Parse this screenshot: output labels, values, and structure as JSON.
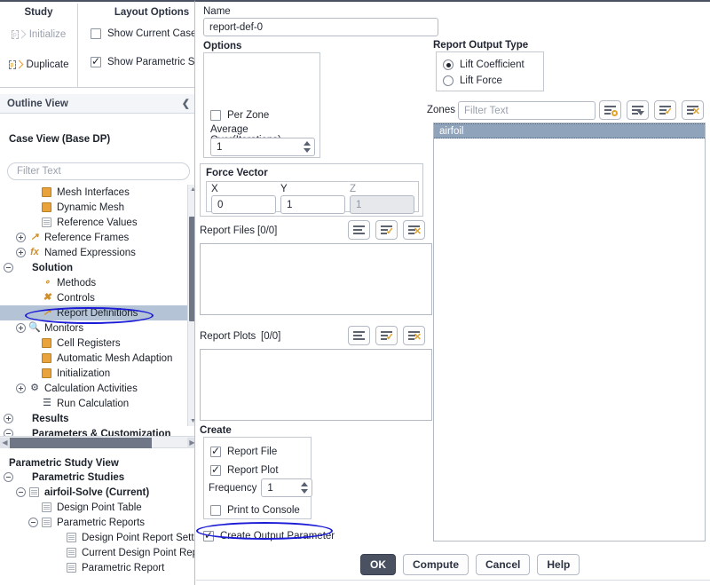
{
  "ribbon": {
    "study": {
      "title": "Study",
      "items": [
        {
          "label": "Initialize",
          "icon": "initialize-icon",
          "disabled": true
        },
        {
          "label": "Duplicate",
          "icon": "duplicate-icon",
          "disabled": false
        }
      ]
    },
    "layout": {
      "title": "Layout Options",
      "items": [
        {
          "label": "Show Current Case Panel",
          "checked": false
        },
        {
          "label": "Show Parametric Study Panel",
          "checked": true
        }
      ]
    }
  },
  "outline": {
    "header": "Outline View",
    "collapse_icon": "chevron-left-icon",
    "case_view_title": "Case View (Base DP)",
    "filter_placeholder": "Filter Text",
    "nodes": [
      {
        "label": "Mesh Interfaces",
        "indent": 2,
        "toggle": "none",
        "icon": "mesh-interfaces-icon",
        "bold": false,
        "selected": false
      },
      {
        "label": "Dynamic Mesh",
        "indent": 2,
        "toggle": "none",
        "icon": "dynamic-mesh-icon",
        "bold": false,
        "selected": false
      },
      {
        "label": "Reference Values",
        "indent": 2,
        "toggle": "none",
        "icon": "reference-values-icon",
        "bold": false,
        "selected": false
      },
      {
        "label": "Reference Frames",
        "indent": 1,
        "toggle": "plus",
        "icon": "reference-frames-icon",
        "bold": false,
        "selected": false
      },
      {
        "label": "Named Expressions",
        "indent": 1,
        "toggle": "plus",
        "icon": "named-expressions-icon",
        "bold": false,
        "selected": false
      },
      {
        "label": "Solution",
        "indent": 0,
        "toggle": "minus",
        "icon": "none",
        "bold": true,
        "selected": false
      },
      {
        "label": "Methods",
        "indent": 2,
        "toggle": "none",
        "icon": "methods-icon",
        "bold": false,
        "selected": false
      },
      {
        "label": "Controls",
        "indent": 2,
        "toggle": "none",
        "icon": "controls-icon",
        "bold": false,
        "selected": false
      },
      {
        "label": "Report Definitions",
        "indent": 2,
        "toggle": "none",
        "icon": "report-definitions-icon",
        "bold": false,
        "selected": true
      },
      {
        "label": "Monitors",
        "indent": 1,
        "toggle": "plus",
        "icon": "monitors-icon",
        "bold": false,
        "selected": false
      },
      {
        "label": "Cell Registers",
        "indent": 2,
        "toggle": "none",
        "icon": "cell-registers-icon",
        "bold": false,
        "selected": false
      },
      {
        "label": "Automatic Mesh Adaption",
        "indent": 2,
        "toggle": "none",
        "icon": "mesh-adaption-icon",
        "bold": false,
        "selected": false
      },
      {
        "label": "Initialization",
        "indent": 2,
        "toggle": "none",
        "icon": "initialization-icon",
        "bold": false,
        "selected": false
      },
      {
        "label": "Calculation Activities",
        "indent": 1,
        "toggle": "plus",
        "icon": "calculation-activities-icon",
        "bold": false,
        "selected": false
      },
      {
        "label": "Run Calculation",
        "indent": 2,
        "toggle": "none",
        "icon": "run-calculation-icon",
        "bold": false,
        "selected": false
      },
      {
        "label": "Results",
        "indent": 0,
        "toggle": "plus",
        "icon": "none",
        "bold": true,
        "selected": false
      },
      {
        "label": "Parameters & Customization",
        "indent": 0,
        "toggle": "minus",
        "icon": "none",
        "bold": true,
        "selected": false
      }
    ]
  },
  "parametric": {
    "header": "Parametric Study View",
    "nodes": [
      {
        "label": "Parametric Studies",
        "indent": 0,
        "toggle": "minus",
        "icon": "none",
        "bold": true
      },
      {
        "label": "airfoil-Solve (Current)",
        "indent": 1,
        "toggle": "minus",
        "icon": "study-icon",
        "bold": true
      },
      {
        "label": "Design Point Table",
        "indent": 2,
        "toggle": "none",
        "icon": "design-point-table-icon",
        "bold": false
      },
      {
        "label": "Parametric Reports",
        "indent": 2,
        "toggle": "minus",
        "icon": "parametric-reports-icon",
        "bold": false
      },
      {
        "label": "Design Point Report Settings",
        "indent": 4,
        "toggle": "none",
        "icon": "report-icon",
        "bold": false
      },
      {
        "label": "Current Design Point Report",
        "indent": 4,
        "toggle": "none",
        "icon": "report-icon",
        "bold": false
      },
      {
        "label": "Parametric Report",
        "indent": 4,
        "toggle": "none",
        "icon": "report-icon",
        "bold": false
      }
    ]
  },
  "dialog": {
    "name_label": "Name",
    "name_value": "report-def-0",
    "options": {
      "title": "Options",
      "per_zone_label": "Per Zone",
      "per_zone_checked": false,
      "average_over_label": "Average Over(Iterations)",
      "average_over_value": "1"
    },
    "force_vector": {
      "title": "Force Vector",
      "x_label": "X",
      "y_label": "Y",
      "z_label": "Z",
      "x_value": "0",
      "y_value": "1",
      "z_value": "1",
      "z_readonly": true
    },
    "report_output_type": {
      "title": "Report Output Type",
      "options": [
        {
          "label": "Lift Coefficient",
          "selected": true
        },
        {
          "label": "Lift Force",
          "selected": false
        }
      ]
    },
    "zones": {
      "label": "Zones",
      "filter_placeholder": "Filter Text",
      "items": [
        "airfoil"
      ],
      "selected": "airfoil",
      "toolbar": [
        {
          "name": "highlight-zones-icon",
          "kind": "circle"
        },
        {
          "name": "zone-filter-dropdown-icon",
          "kind": "caret"
        },
        {
          "name": "select-all-zones-icon",
          "kind": "check"
        },
        {
          "name": "deselect-all-zones-icon",
          "kind": "cross"
        }
      ]
    },
    "report_files": {
      "label": "Report Files",
      "count": "[0/0]",
      "items": [],
      "toolbar": [
        {
          "name": "list-report-files-icon",
          "kind": "plain"
        },
        {
          "name": "select-all-report-files-icon",
          "kind": "check"
        },
        {
          "name": "deselect-all-report-files-icon",
          "kind": "cross"
        }
      ]
    },
    "report_plots": {
      "label": "Report Plots",
      "count": "[0/0]",
      "items": [],
      "toolbar": [
        {
          "name": "list-report-plots-icon",
          "kind": "plain"
        },
        {
          "name": "select-all-report-plots-icon",
          "kind": "check"
        },
        {
          "name": "deselect-all-report-plots-icon",
          "kind": "cross"
        }
      ]
    },
    "create": {
      "title": "Create",
      "report_file_label": "Report File",
      "report_file_checked": true,
      "report_plot_label": "Report Plot",
      "report_plot_checked": true,
      "frequency_label": "Frequency",
      "frequency_value": "1",
      "print_to_console_label": "Print to Console",
      "print_to_console_checked": false
    },
    "create_output_parameter_label": "Create Output Parameter",
    "create_output_parameter_checked": true,
    "buttons": [
      {
        "label": "OK",
        "primary": true
      },
      {
        "label": "Compute",
        "primary": false
      },
      {
        "label": "Cancel",
        "primary": false
      },
      {
        "label": "Help",
        "primary": false
      }
    ]
  },
  "colors": {
    "accent_orange": "#e0a32c",
    "selection_blue": "#b4c4d6",
    "list_selection": "#8fa3ba",
    "annotation": "#1a1ad6",
    "primary_button": "#4a5161"
  }
}
